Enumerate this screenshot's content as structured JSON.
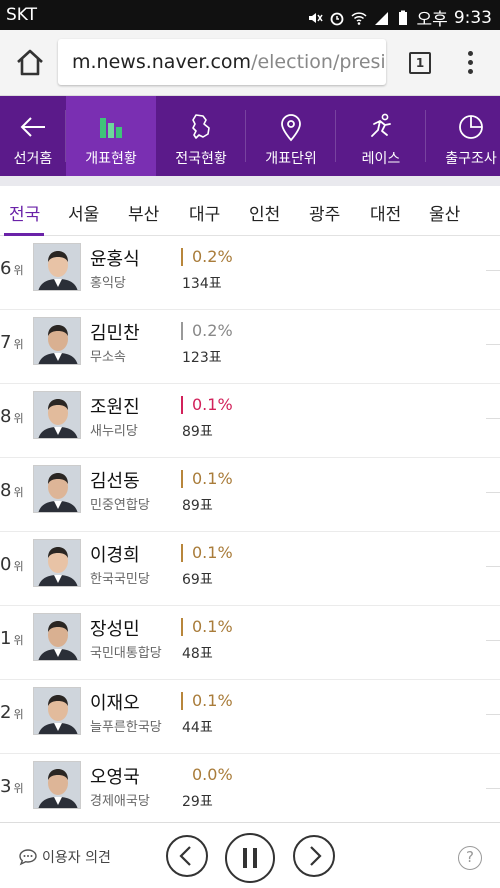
{
  "status_bar": {
    "carrier": "SKT",
    "ampm": "오후",
    "time": "9:33"
  },
  "browser": {
    "url_host": "m.news.naver.com",
    "url_path": "/election/presid",
    "tab_count": "1"
  },
  "nav": {
    "items": [
      {
        "label": "선거홈",
        "icon": "back-arrow-icon"
      },
      {
        "label": "개표현황",
        "icon": "bar-chart-icon",
        "active": true
      },
      {
        "label": "전국현황",
        "icon": "korea-map-icon"
      },
      {
        "label": "개표단위",
        "icon": "location-pin-icon"
      },
      {
        "label": "레이스",
        "icon": "runner-icon"
      },
      {
        "label": "출구조사",
        "icon": "pie-chart-icon"
      }
    ],
    "accent": "#5b1a8a"
  },
  "regions": [
    "전국",
    "서울",
    "부산",
    "대구",
    "인천",
    "광주",
    "대전",
    "울산"
  ],
  "rank_suffix": "위",
  "candidates": [
    {
      "rank": "6",
      "name": "윤홍식",
      "party": "홍익당",
      "pct": "0.2%",
      "votes": "134표",
      "bar_color": "#b8863b",
      "pct_color": "#a97c3a"
    },
    {
      "rank": "7",
      "name": "김민찬",
      "party": "무소속",
      "pct": "0.2%",
      "votes": "123표",
      "bar_color": "#999999",
      "pct_color": "#888888"
    },
    {
      "rank": "8",
      "name": "조원진",
      "party": "새누리당",
      "pct": "0.1%",
      "votes": "89표",
      "bar_color": "#d2215a",
      "pct_color": "#d2215a"
    },
    {
      "rank": "8",
      "name": "김선동",
      "party": "민중연합당",
      "pct": "0.1%",
      "votes": "89표",
      "bar_color": "#b8863b",
      "pct_color": "#a97c3a"
    },
    {
      "rank": "0",
      "name": "이경희",
      "party": "한국국민당",
      "pct": "0.1%",
      "votes": "69표",
      "bar_color": "#b8863b",
      "pct_color": "#a97c3a"
    },
    {
      "rank": "1",
      "name": "장성민",
      "party": "국민대통합당",
      "pct": "0.1%",
      "votes": "48표",
      "bar_color": "#b8863b",
      "pct_color": "#a97c3a"
    },
    {
      "rank": "2",
      "name": "이재오",
      "party": "늘푸른한국당",
      "pct": "0.1%",
      "votes": "44표",
      "bar_color": "#b8863b",
      "pct_color": "#a97c3a"
    },
    {
      "rank": "3",
      "name": "오영국",
      "party": "경제애국당",
      "pct": "0.0%",
      "votes": "29표",
      "bar_color": "",
      "pct_color": "#a97c3a"
    }
  ],
  "bottom": {
    "feedback_label": "이용자 의견",
    "help": "?"
  }
}
